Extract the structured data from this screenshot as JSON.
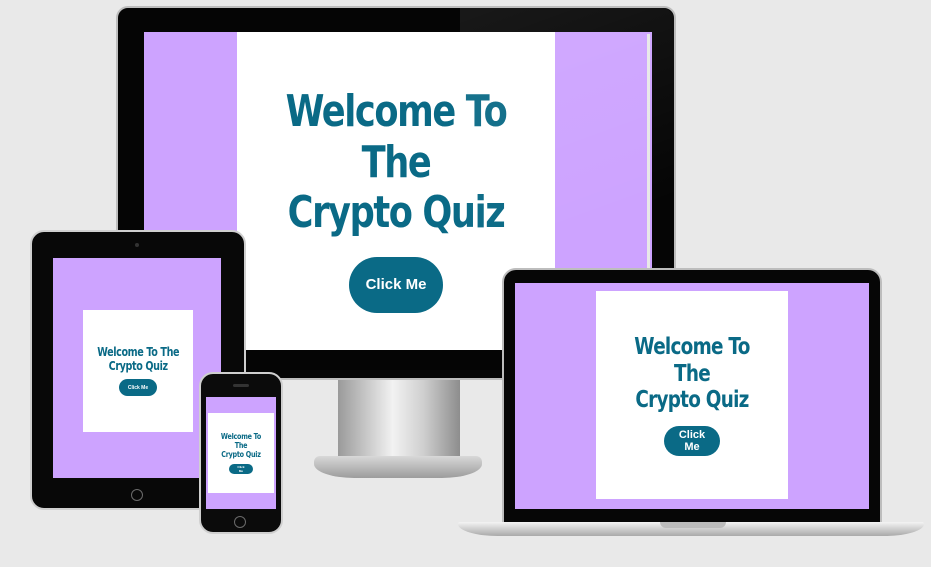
{
  "screens": {
    "desktop": {
      "title_line1": "Welcome To The",
      "title_line2": "Crypto Quiz",
      "button": "Click Me"
    },
    "tablet": {
      "title_line1": "Welcome To The",
      "title_line2": "Crypto Quiz",
      "button": "Click Me"
    },
    "laptop": {
      "title_line1": "Welcome To The",
      "title_line2": "Crypto Quiz",
      "button": "Click Me"
    },
    "phone": {
      "title_line1": "Welcome To The",
      "title_line2": "Crypto Quiz",
      "button": "Click Me"
    }
  },
  "colors": {
    "page_background": "#e9e9e9",
    "screen_background": "#cda3ff",
    "card_background": "#ffffff",
    "accent": "#0a6a86"
  },
  "icons": [
    "home-button-icon",
    "camera-icon",
    "speaker-icon"
  ]
}
